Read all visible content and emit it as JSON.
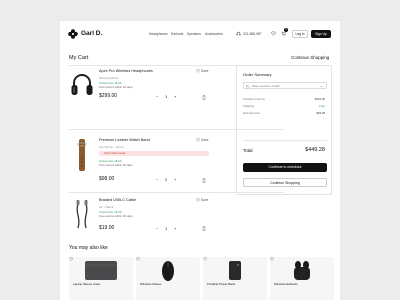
{
  "header": {
    "brand": "Garl D.",
    "nav": [
      "Headphones",
      "Earbuds",
      "Speakers",
      "Accessories"
    ],
    "phone": "221-658-987",
    "cart_count": "1",
    "login_label": "Log in",
    "signup_label": "Sign Up"
  },
  "cart": {
    "title": "My Cart",
    "continue_label": "Continue Shopping",
    "items": [
      {
        "name": "Apex Pro Wireless Headphones",
        "sub": "Midnight Black",
        "meta": [
          "Arrives Dec 18-20",
          "Free returns within 30 days"
        ],
        "note": "",
        "price": "$299.00",
        "qty": "1",
        "save_label": "Save"
      },
      {
        "name": "Premium Leather Watch Band",
        "sub": "Tan Brown • 42mm",
        "meta": [
          "Arrives Dec 18-20",
          "Free returns within 30 days"
        ],
        "note": "Only 2 left in stock",
        "price": "$98.00",
        "qty": "2",
        "save_label": "Save"
      },
      {
        "name": "Braided USB-C Cable",
        "sub": "2m • Black",
        "meta": [
          "Arrives Dec 18-20",
          "Free returns within 30 days"
        ],
        "note": "",
        "price": "$19.00",
        "qty": "1",
        "save_label": "Save"
      }
    ]
  },
  "summary": {
    "title": "Order Summary",
    "promo_placeholder": "Have a promo code?",
    "rows": [
      {
        "label": "Subtotal (3 items)",
        "value": "$416.00"
      },
      {
        "label": "Shipping",
        "value": "Free"
      },
      {
        "label": "Estimated tax",
        "value": "$33.28"
      }
    ],
    "total_label": "Total",
    "total_value": "$449.28",
    "checkout_label": "Continue to checkout",
    "continue_label": "Continue Shopping"
  },
  "recommendations": {
    "title": "You may also like",
    "items": [
      {
        "name": "Laptop Sleeve Case"
      },
      {
        "name": "Wireless Mouse"
      },
      {
        "name": "Portable Power Bank"
      },
      {
        "name": "Wireless Earbuds"
      }
    ]
  },
  "colors": {
    "accent": "#111111",
    "success": "#2a9d55",
    "warning_bg": "#fbe1e1",
    "warning_text": "#c0392b"
  }
}
